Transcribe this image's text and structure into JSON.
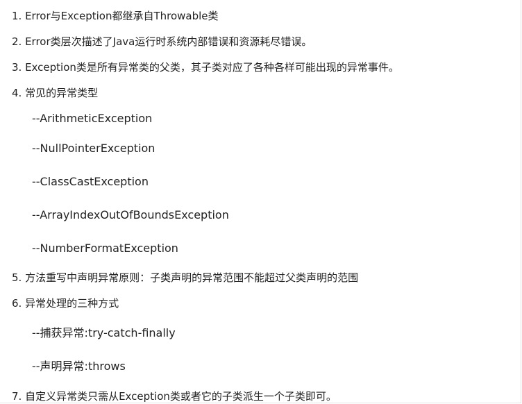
{
  "items": [
    "1. Error与Exception都继承自Throwable类",
    "2. Error类层次描述了Java运行时系统内部错误和资源耗尽错误。",
    "3. Exception类是所有异常类的父类，其子类对应了各种各样可能出现的异常事件。",
    "4. 常见的异常类型",
    "--ArithmeticException",
    "--NullPointerException",
    "--ClassCastException",
    "--ArrayIndexOutOfBoundsException",
    "--NumberFormatException",
    "5. 方法重写中声明异常原则：子类声明的异常范围不能超过父类声明的范围",
    "6. 异常处理的三种方式",
    "--捕获异常:try-catch-finally",
    "--声明异常:throws",
    "7. 自定义异常类只需从Exception类或者它的子类派生一个子类即可。"
  ]
}
